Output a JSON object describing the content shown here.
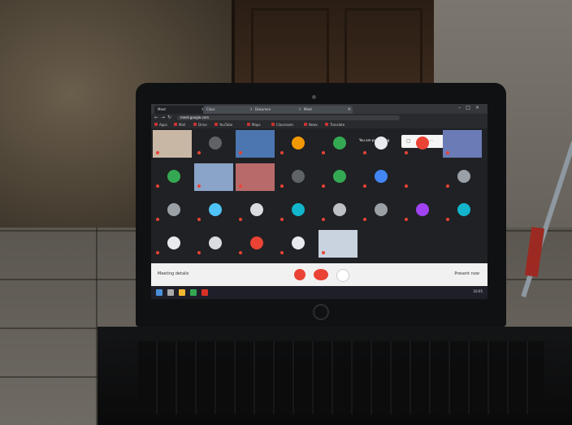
{
  "browser": {
    "tabs": [
      {
        "label": "Meet",
        "active": true
      },
      {
        "label": "Class",
        "active": false
      },
      {
        "label": "Dokumen",
        "active": false
      },
      {
        "label": "Meet",
        "active": false
      }
    ],
    "url": "meet.google.com",
    "bookmarks": [
      "Apps",
      "Mail",
      "Drive",
      "YouTube",
      "Maps",
      "Classroom",
      "News",
      "Translate"
    ]
  },
  "meet": {
    "presenting_text": "You are presenting",
    "participants": [
      {
        "name": "",
        "type": "camera",
        "color": "#c9b7a5"
      },
      {
        "name": "",
        "type": "avatar",
        "color": "#5f6368"
      },
      {
        "name": "",
        "type": "camera",
        "color": "#4b76b0"
      },
      {
        "name": "",
        "type": "avatar",
        "color": "#f29900"
      },
      {
        "name": "",
        "type": "avatar",
        "color": "#34a853"
      },
      {
        "name": "",
        "type": "avatar",
        "color": "#e8eaed"
      },
      {
        "name": "",
        "type": "avatar",
        "color": "#ea4335"
      },
      {
        "name": "",
        "type": "camera",
        "color": "#6a7bb5"
      },
      {
        "name": "",
        "type": "avatar",
        "color": "#34a853"
      },
      {
        "name": "",
        "type": "camera",
        "color": "#8aa3c8"
      },
      {
        "name": "",
        "type": "camera",
        "color": "#b86a6a"
      },
      {
        "name": "",
        "type": "avatar",
        "color": "#5f6368"
      },
      {
        "name": "",
        "type": "avatar",
        "color": "#34a853"
      },
      {
        "name": "",
        "type": "avatar",
        "color": "#4285f4"
      },
      {
        "name": "",
        "type": "avatar",
        "color": "#202124"
      },
      {
        "name": "",
        "type": "avatar",
        "color": "#9aa0a6"
      },
      {
        "name": "",
        "type": "avatar",
        "color": "#9aa0a6"
      },
      {
        "name": "",
        "type": "avatar",
        "color": "#4fc3f7"
      },
      {
        "name": "",
        "type": "avatar",
        "color": "#dadce0"
      },
      {
        "name": "",
        "type": "avatar",
        "color": "#12b5cb"
      },
      {
        "name": "",
        "type": "avatar",
        "color": "#bdc1c6"
      },
      {
        "name": "",
        "type": "avatar",
        "color": "#9aa0a6"
      },
      {
        "name": "",
        "type": "avatar",
        "color": "#a142f4"
      },
      {
        "name": "",
        "type": "avatar",
        "color": "#12b5cb"
      },
      {
        "name": "",
        "type": "avatar",
        "color": "#e8eaed"
      },
      {
        "name": "",
        "type": "avatar",
        "color": "#dadce0"
      },
      {
        "name": "",
        "type": "avatar",
        "color": "#ea4335"
      },
      {
        "name": "",
        "type": "avatar",
        "color": "#e8eaed"
      },
      {
        "name": "",
        "type": "camera",
        "color": "#c9d3e0"
      }
    ]
  },
  "controls": {
    "left_label": "Meeting details",
    "right_label": "Present now",
    "mic_color": "#ea4335",
    "hangup_color": "#ea4335"
  },
  "taskbar": {
    "time": "10:05"
  },
  "colors": {
    "meet_bg": "#202124",
    "accent_red": "#ea4335"
  }
}
